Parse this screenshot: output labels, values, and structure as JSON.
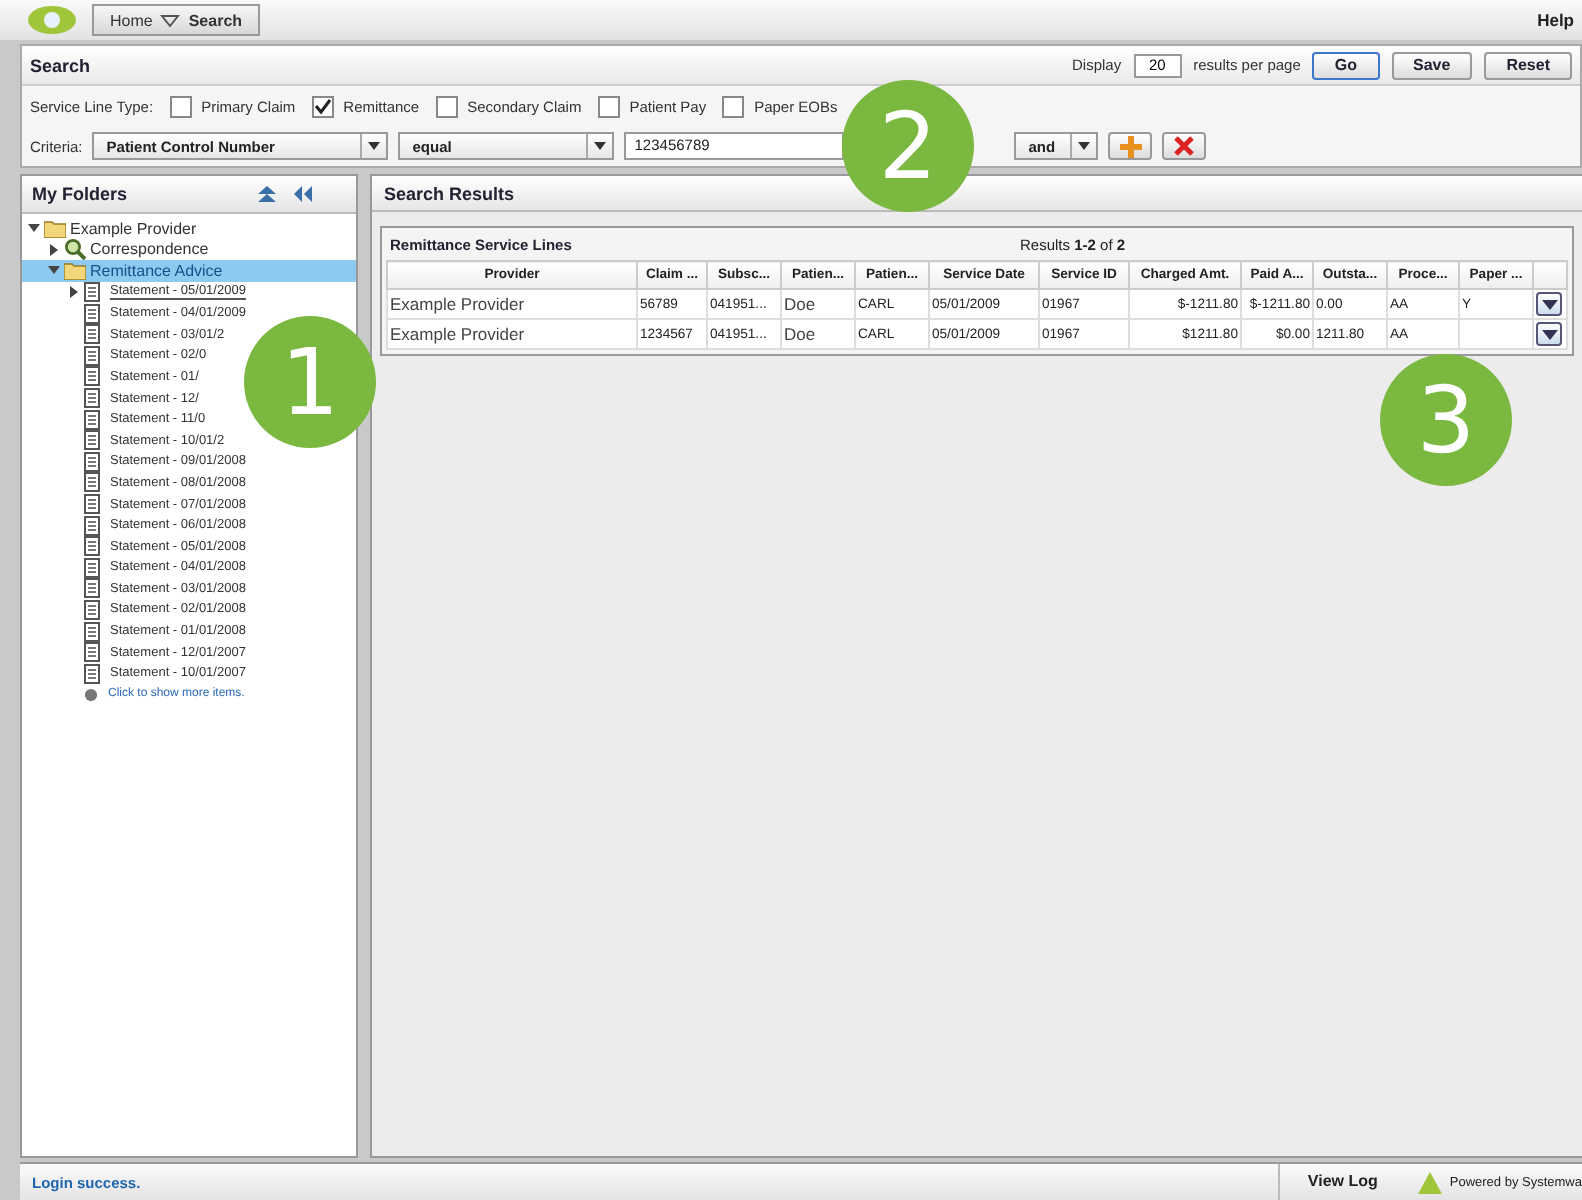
{
  "breadcrumb": {
    "items": [
      "Home",
      "Search"
    ]
  },
  "help": "Help",
  "search": {
    "title": "Search",
    "display_label": "Display",
    "per_page": "20",
    "per_page_suffix": "results per page",
    "buttons": [
      "Go",
      "Save",
      "Reset"
    ],
    "service_line_label": "Service Line Type:",
    "types": [
      {
        "label": "Primary Claim",
        "checked": false
      },
      {
        "label": "Remittance",
        "checked": true
      },
      {
        "label": "Secondary Claim",
        "checked": false
      },
      {
        "label": "Patient Pay",
        "checked": false
      },
      {
        "label": "Paper EOBs",
        "checked": false
      }
    ],
    "criteria_label": "Criteria:",
    "field": "Patient Control Number",
    "operator": "equal",
    "value": "123456789",
    "join": "and"
  },
  "folders": {
    "title": "My Folders",
    "tree": [
      {
        "label": "Example Provider",
        "kind": "folder",
        "expanded": true,
        "selected": false,
        "children": [
          {
            "label": "Correspondence",
            "kind": "search",
            "expanded": false,
            "selected": false
          },
          {
            "label": "Remittance Advice",
            "kind": "folder",
            "expanded": true,
            "selected": true,
            "children": [
              {
                "label": "Statement - 05/01/2009",
                "kind": "doc",
                "expanded": false,
                "selected": false,
                "underline": true
              },
              {
                "label": "Statement - 04/01/2009",
                "kind": "doc"
              },
              {
                "label": "Statement - 03/01/2",
                "kind": "doc"
              },
              {
                "label": "Statement - 02/0",
                "kind": "doc"
              },
              {
                "label": "Statement - 01/",
                "kind": "doc"
              },
              {
                "label": "Statement - 12/",
                "kind": "doc"
              },
              {
                "label": "Statement - 11/0",
                "kind": "doc"
              },
              {
                "label": "Statement - 10/01/2",
                "kind": "doc"
              },
              {
                "label": "Statement - 09/01/2008",
                "kind": "doc"
              },
              {
                "label": "Statement - 08/01/2008",
                "kind": "doc"
              },
              {
                "label": "Statement - 07/01/2008",
                "kind": "doc"
              },
              {
                "label": "Statement - 06/01/2008",
                "kind": "doc"
              },
              {
                "label": "Statement - 05/01/2008",
                "kind": "doc"
              },
              {
                "label": "Statement - 04/01/2008",
                "kind": "doc"
              },
              {
                "label": "Statement - 03/01/2008",
                "kind": "doc"
              },
              {
                "label": "Statement - 02/01/2008",
                "kind": "doc"
              },
              {
                "label": "Statement - 01/01/2008",
                "kind": "doc"
              },
              {
                "label": "Statement - 12/01/2007",
                "kind": "doc"
              },
              {
                "label": "Statement - 10/01/2007",
                "kind": "doc"
              },
              {
                "label": "Click to show more items.",
                "kind": "more"
              }
            ]
          }
        ]
      }
    ]
  },
  "results": {
    "title": "Search Results",
    "grid_title": "Remittance Service Lines",
    "summary": "Results **1-2** of **2**",
    "columns": [
      "Provider",
      "Claim ...",
      "Subsc...",
      "Patien...",
      "Patien...",
      "Service Date",
      "Service ID",
      "Charged Amt.",
      "Paid A...",
      "Outsta...",
      "Proce...",
      "Paper ..."
    ],
    "rows": [
      [
        "Example Provider",
        "56789",
        "041951...",
        "Doe",
        "CARL",
        "05/01/2009",
        "01967",
        "$-1211.80",
        "$-1211.80",
        "0.00",
        "AA",
        "Y"
      ],
      [
        "Example Provider",
        "1234567",
        "041951...",
        "Doe",
        "CARL",
        "05/01/2009",
        "01967",
        "$1211.80",
        "$0.00",
        "1211.80",
        "AA",
        ""
      ]
    ]
  },
  "callouts": [
    "1",
    "2",
    "3"
  ],
  "status_bar": {
    "message": "Login success.",
    "view_log": "View Log",
    "powered": "Powered by Systemwa"
  }
}
